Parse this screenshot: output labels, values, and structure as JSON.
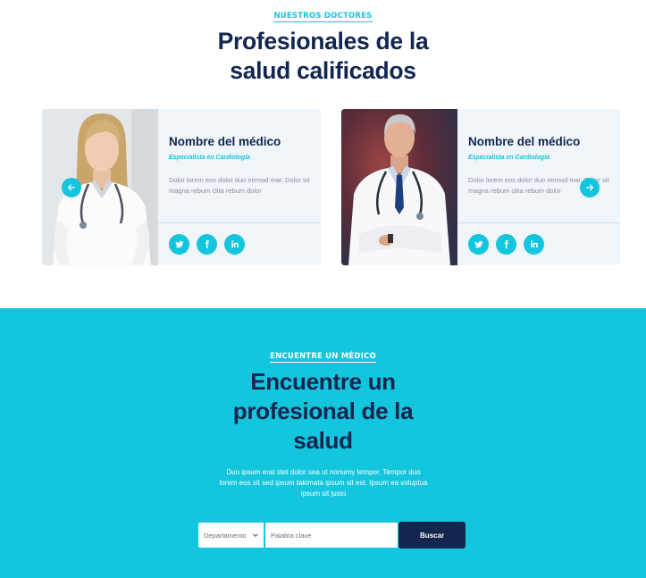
{
  "doctors": {
    "eyebrow": "NUESTROS DOCTORES",
    "title_line1": "Profesionales de la",
    "title_line2": "salud calificados",
    "cards": [
      {
        "name": "Nombre del médico",
        "specialty": "Especialista en Cardiología",
        "description": "Dolor lorem eos dolor duo eirmod mar. Dolor sit magna rebum clita rebum dolor"
      },
      {
        "name": "Nombre del médico",
        "specialty": "Especialista en Cardiología",
        "description": "Dolor lorem eos dolor duo eirmod mar. Dolor sit magna rebum clita rebum dolor"
      }
    ],
    "social_icons": [
      "twitter-icon",
      "facebook-icon",
      "linkedin-icon"
    ]
  },
  "search": {
    "eyebrow": "ENCUENTRE UN MÉDICO",
    "title_line1": "Encuentre un",
    "title_line2": "profesional de la",
    "title_line3": "salud",
    "lead": "Duo ipsum erat stet dolor sea ut nonumy tempor. Tempor duo lorem eos sit sed ipsum takimata ipsum sit est. Ipsum ea voluptua ipsum sit justo",
    "select_value": "Departamento",
    "keyword_placeholder": "Palabra clave",
    "button_label": "Buscar"
  },
  "colors": {
    "accent": "#13c5dd",
    "navy": "#13264f",
    "card_bg": "#eff5f9"
  }
}
